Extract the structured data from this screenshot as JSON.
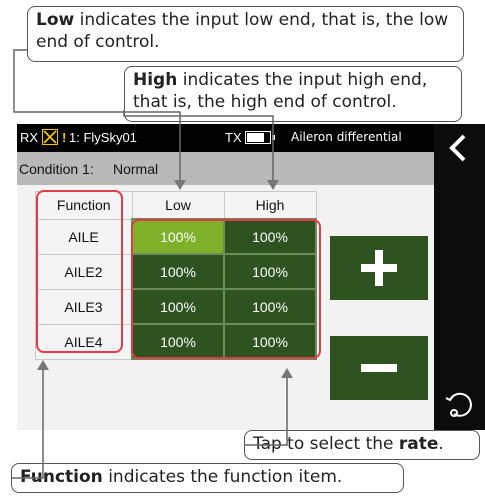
{
  "callouts": {
    "low_bold": "Low",
    "low_text": " indicates the input low end, that is, the low end of control.",
    "high_bold": "High",
    "high_text": " indicates the input high end, that is, the high end of control.",
    "rate_pre": "Tap to select the ",
    "rate_bold": "rate",
    "rate_post": ".",
    "function_bold": "Function",
    "function_text": " indicates the function item."
  },
  "statusbar": {
    "rx_label": "RX",
    "model_name": "1: FlySky01",
    "tx_label": "TX",
    "page_title": "Aileron differential"
  },
  "condition": {
    "label": "Condition 1:",
    "value": "Normal"
  },
  "table": {
    "headers": [
      "Function",
      "Low",
      "High"
    ],
    "rows": [
      {
        "function": "AILE",
        "low": "100%",
        "high": "100%",
        "selected": "low"
      },
      {
        "function": "AILE2",
        "low": "100%",
        "high": "100%"
      },
      {
        "function": "AILE3",
        "low": "100%",
        "high": "100%"
      },
      {
        "function": "AILE4",
        "low": "100%",
        "high": "100%"
      }
    ]
  },
  "buttons": {
    "plus_icon": "plus-icon",
    "minus_icon": "minus-icon",
    "back_icon": "chevron-left-icon",
    "rotate_icon": "rotate-icon"
  },
  "colors": {
    "value_cell": "#2e5220",
    "value_cell_selected": "#7fb02a",
    "highlight": "#e23b4a",
    "rx_warning": "#f2c200"
  }
}
